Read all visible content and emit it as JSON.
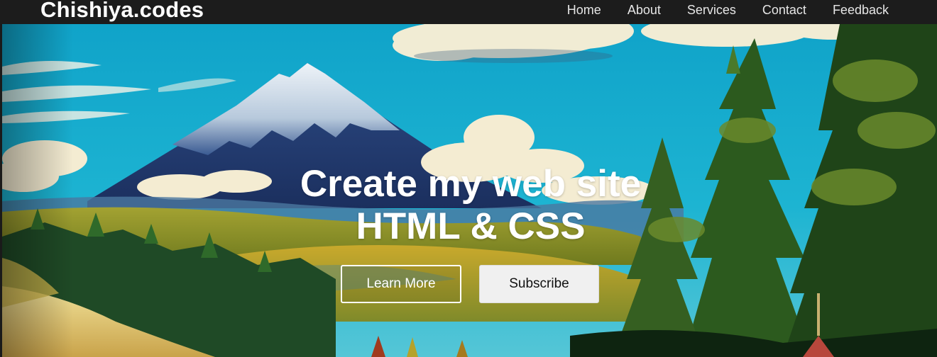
{
  "brand": {
    "logo_text": "Chishiya.codes"
  },
  "nav": {
    "items": [
      {
        "label": "Home"
      },
      {
        "label": "About"
      },
      {
        "label": "Services"
      },
      {
        "label": "Contact"
      },
      {
        "label": "Feedback"
      }
    ]
  },
  "hero": {
    "title_line1": "Create my web site",
    "title_line2": "HTML & CSS",
    "primary_button": "Learn More",
    "secondary_button": "Subscribe",
    "image_description_icon": "mountain-landscape-image"
  },
  "colors": {
    "navbar_bg": "#1c1c1c",
    "sky": "#1fa6c9",
    "button_outline": "#ffffff",
    "button_solid_bg": "#f0f0f0"
  }
}
